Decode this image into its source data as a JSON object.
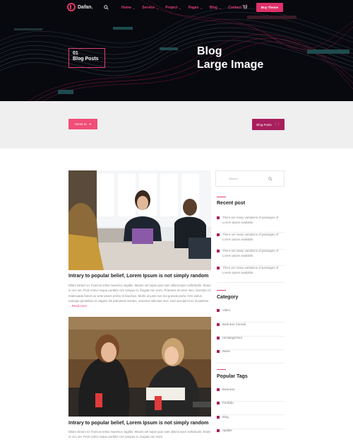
{
  "header": {
    "logo_text": "Dafan.",
    "menu": [
      {
        "label": "Home"
      },
      {
        "label": "Service"
      },
      {
        "label": "Project"
      },
      {
        "label": "Pages"
      },
      {
        "label": "Blog"
      },
      {
        "label": "Contact"
      }
    ],
    "buy_label": "Buy Theme"
  },
  "hero": {
    "crumb_number": "01",
    "crumb_label": "Blog Posts",
    "title_line1": "Blog",
    "title_line2": "Large Image"
  },
  "band": {
    "left_label": "Home to",
    "right_label": "Blog Posts"
  },
  "posts": [
    {
      "title": "Intrary to popular belief, Lorem Ipsum is not simply random",
      "excerpt": "Dilam dictum ex rhoncus tellus maximus sagittis. Mauris vel turpis quis nam ullamcorper sollicitudin. Etiam in orci nec Proin tortor neque porttitor nec tempus in, feugiat non enim. Praesent id tortor sem, interdum et malesuada fames ac ante ipsum primis in faucibus. Morbi ut justo non dui gravida porta. Orci varius natoque penatibus et magnis dis parturient montes, nascetur ridiculus mus. Sed suscipit id ex id pulvinar. ...",
      "read_more": "Read more"
    },
    {
      "title": "Intrary to popular belief, Lorem Ipsum is not simply random",
      "excerpt": "Dilam dictum ex rhoncus tellus maximus sagittis. Mauris vel turpis quis nam ullamcorper sollicitudin. Etiam in orci nec Proin tortor neque porttitor nec tempus in, feugiat non enim."
    }
  ],
  "sidebar": {
    "search_placeholder": "Search",
    "recent_heading": "Recent post",
    "recent": [
      {
        "text": "There are many variations of passages of Lorem Ipsum available."
      },
      {
        "text": "There are many variations of passages of Lorem Ipsum available."
      },
      {
        "text": "There are many variations of passages of Lorem Ipsum available."
      },
      {
        "text": "There are many variations of passages of Lorem Ipsum available."
      }
    ],
    "category_heading": "Category",
    "categories": [
      {
        "label": "Video"
      },
      {
        "label": "Business Consult"
      },
      {
        "label": "Uncategorized"
      },
      {
        "label": "News"
      }
    ],
    "tags_heading": "Popular Tags",
    "tags": [
      {
        "label": "Business"
      },
      {
        "label": "Portfolio"
      },
      {
        "label": "Blog"
      },
      {
        "label": "Update"
      }
    ]
  },
  "colors": {
    "accent": "#e33f72",
    "dark_accent": "#a81f5e",
    "hero_bg": "#07090f"
  }
}
